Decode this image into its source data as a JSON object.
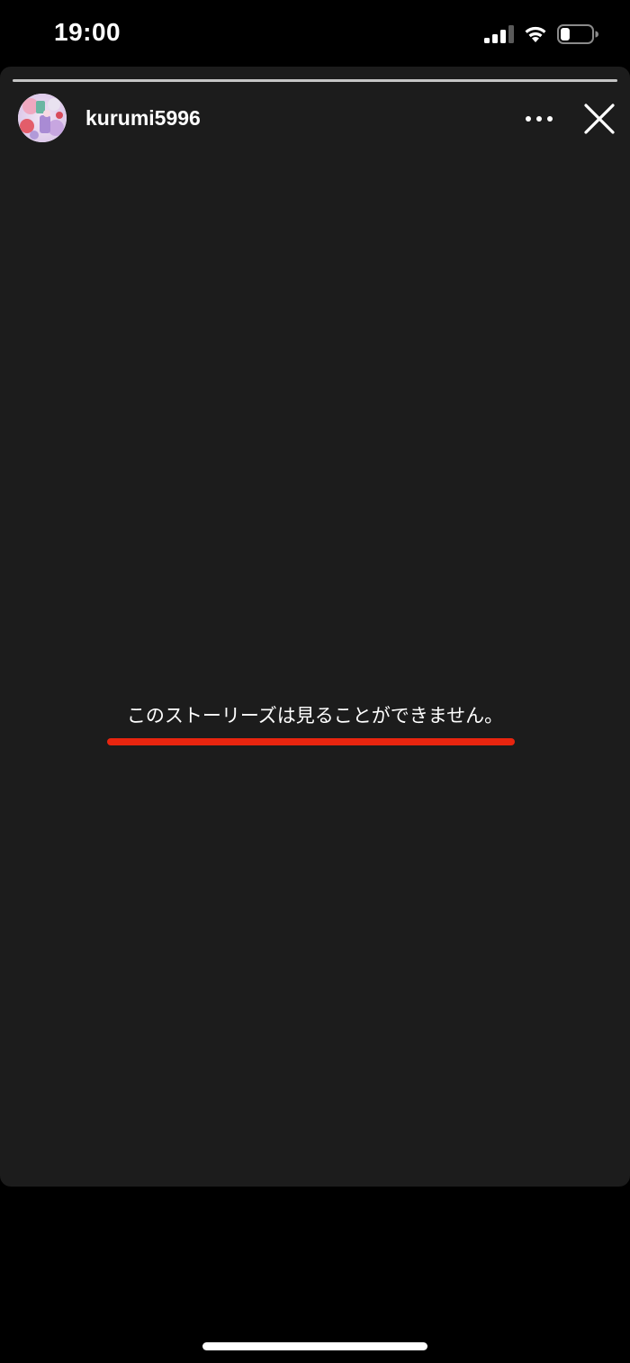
{
  "status_bar": {
    "time": "19:00",
    "signal_icon": "cellular-signal-icon",
    "wifi_icon": "wifi-icon",
    "battery_icon": "battery-icon",
    "battery_level": 0.3
  },
  "story": {
    "progress": 1.0,
    "username": "kurumi5996",
    "avatar_icon": "profile-avatar",
    "more_icon": "more-horizontal-icon",
    "close_icon": "close-icon",
    "message": "このストーリーズは見ることができません。"
  },
  "colors": {
    "panel_background": "#1c1c1c",
    "page_background": "#000000",
    "highlight": "#e8250f"
  }
}
